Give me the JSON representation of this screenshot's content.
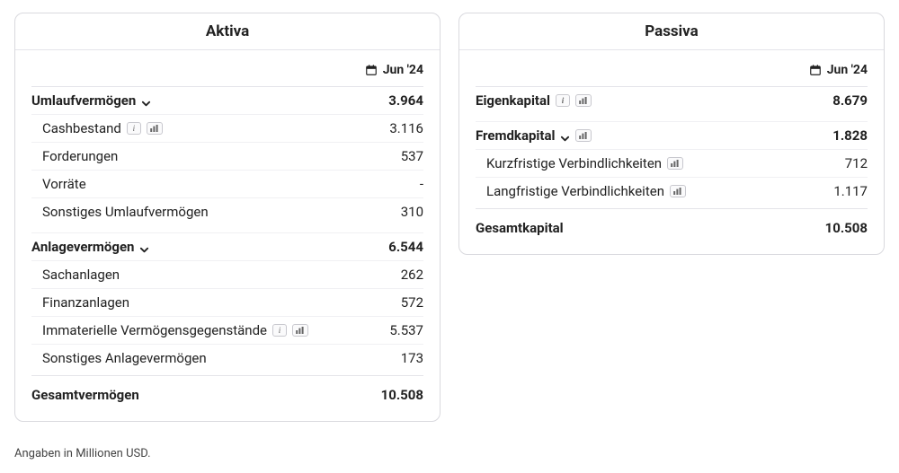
{
  "period_label": "Jun '24",
  "footnote": "Angaben in Millionen USD.",
  "aktiva": {
    "title": "Aktiva",
    "umlauf": {
      "label": "Umlaufvermögen",
      "value": "3.964",
      "items": {
        "cash": {
          "label": "Cashbestand",
          "value": "3.116"
        },
        "forderungen": {
          "label": "Forderungen",
          "value": "537"
        },
        "vorraete": {
          "label": "Vorräte",
          "value": "-"
        },
        "sonstiges": {
          "label": "Sonstiges Umlaufvermögen",
          "value": "310"
        }
      }
    },
    "anlage": {
      "label": "Anlagevermögen",
      "value": "6.544",
      "items": {
        "sach": {
          "label": "Sachanlagen",
          "value": "262"
        },
        "finanz": {
          "label": "Finanzanlagen",
          "value": "572"
        },
        "immat": {
          "label": "Immaterielle Vermögensgegenstände",
          "value": "5.537"
        },
        "sonstiges": {
          "label": "Sonstiges Anlagevermögen",
          "value": "173"
        }
      }
    },
    "total": {
      "label": "Gesamtvermögen",
      "value": "10.508"
    }
  },
  "passiva": {
    "title": "Passiva",
    "eigenkapital": {
      "label": "Eigenkapital",
      "value": "8.679"
    },
    "fremdkapital": {
      "label": "Fremdkapital",
      "value": "1.828",
      "items": {
        "kurz": {
          "label": "Kurzfristige Verbindlichkeiten",
          "value": "712"
        },
        "lang": {
          "label": "Langfristige Verbindlichkeiten",
          "value": "1.117"
        }
      }
    },
    "total": {
      "label": "Gesamtkapital",
      "value": "10.508"
    }
  }
}
